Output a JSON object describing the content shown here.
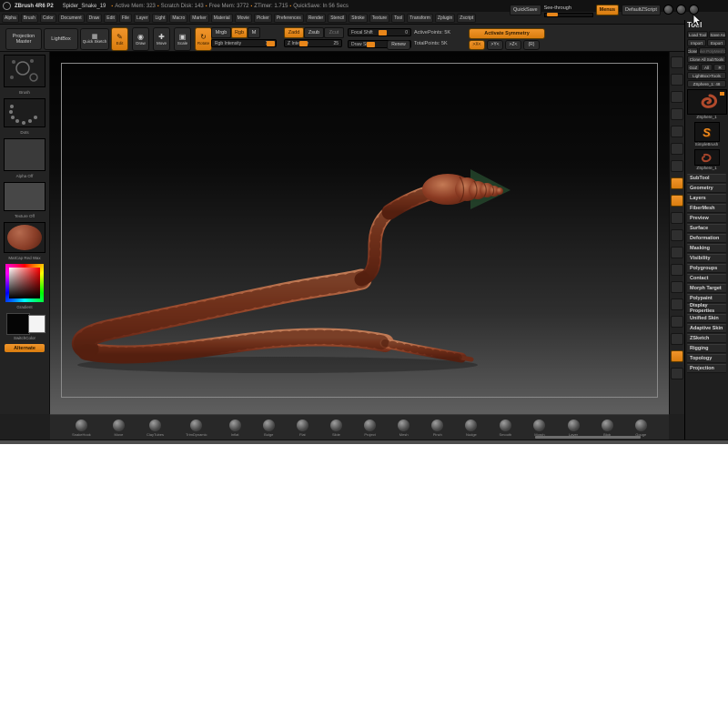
{
  "titlebar": {
    "app_icon_glyph": "◎",
    "app_title": "ZBrush 4R6 P2",
    "doc_title": "Spider_Snake_19",
    "stat_separator": "▪",
    "stats": [
      "Active Mem: 323",
      "Scratch Disk: 143",
      "Free Mem: 3772",
      "ZTimer: 1.715",
      "QuickSave: In 56 Secs"
    ],
    "quicksave": "QuickSave",
    "see_through": "See-through",
    "menus": "Menus",
    "default_zscript": "DefaultZScript"
  },
  "menubar": {
    "items": [
      "Alpha",
      "Brush",
      "Color",
      "Document",
      "Draw",
      "Edit",
      "File",
      "Layer",
      "Light",
      "Macro",
      "Marker",
      "Material",
      "Movie",
      "Picker",
      "Preferences",
      "Render",
      "Stencil",
      "Stroke",
      "Texture",
      "Tool",
      "Transform",
      "Zplugin",
      "Zscript"
    ]
  },
  "shelf": {
    "projection_master": "Projection Master",
    "lightbox": "LightBox",
    "quick_sketch": "Quick Sketch",
    "quick_sketch_glyph": "▦",
    "modes": [
      {
        "label": "Edit",
        "glyph": "✎",
        "icon": "pencil-edit",
        "active": true
      },
      {
        "label": "Draw",
        "glyph": "◉",
        "icon": "draw-dot",
        "active": false
      },
      {
        "label": "Move",
        "glyph": "✚",
        "icon": "move-cross",
        "active": false
      },
      {
        "label": "Scale",
        "glyph": "▣",
        "icon": "scale-box",
        "active": false
      },
      {
        "label": "Rotate",
        "glyph": "↻",
        "icon": "rotate-arrow",
        "active": true
      }
    ],
    "paint": {
      "mrgb": "Mrgb",
      "rgb": "Rgb",
      "m": "M",
      "intensity_label": "Rgb Intensity",
      "intensity_value": "100"
    },
    "sculpt": {
      "zadd": "Zadd",
      "zsub": "Zsub",
      "zcut": "Zcut",
      "intensity_label": "Z Intensity",
      "intensity_value": "25"
    },
    "focal": {
      "label": "Focal Shift",
      "value": "0"
    },
    "draw_size": {
      "label": "Draw Size",
      "value": "64"
    },
    "renew": "Renew",
    "points": {
      "active_label": "ActivePoints:",
      "active_value": "5K",
      "total_label": "TotalPoints:",
      "total_value": "5K"
    },
    "symmetry": {
      "activate": "Activate Symmetry",
      "x": ">X<",
      "y": ">Y<",
      "z": ">Z<",
      "r": "(R)"
    }
  },
  "left_shelf": {
    "brush_label": "Brush",
    "stroke_label": "Dots",
    "alpha_label": "Alpha Off",
    "texture_label": "Texture Off",
    "material_label": "MatCap Red Wax",
    "gradient_label": "Gradient",
    "switch_label": "SwitchColor",
    "alternate_label": "Alternate"
  },
  "right_strip": {
    "button_count": 19,
    "active_indexes": [
      7,
      8,
      17
    ]
  },
  "tool_panel": {
    "header": "Tool",
    "rows": [
      [
        "Load Tool",
        "Save As"
      ],
      [
        "Import",
        "Export"
      ],
      [
        "Clone",
        "Make PolyMesh3D"
      ],
      [
        "Clone All SubTools"
      ],
      [
        "GoZ",
        "All",
        "R"
      ],
      [
        "LightBox>Tools"
      ],
      [
        "ZSphere_1: 48"
      ]
    ],
    "disabled_button": "Make PolyMesh3D",
    "active_tool_label": "ZSphere_1",
    "slot1_glyph": "S",
    "slot1_label": "SimpleBrush",
    "slot2_label": "ZSphere_1",
    "sections": [
      "SubTool",
      "Geometry",
      "Layers",
      "FiberMesh",
      "Preview",
      "Surface",
      "Deformation",
      "Masking",
      "Visibility",
      "Polygroups",
      "Contact",
      "Morph Target",
      "Polypaint",
      "Display Properties",
      "Unified Skin",
      "Adaptive Skin",
      "ZSketch",
      "Rigging",
      "Topology",
      "Projection"
    ]
  },
  "bottom_tray": {
    "items": [
      {
        "label": "SnakeHook"
      },
      {
        "label": "Move"
      },
      {
        "label": "ClayTubes"
      },
      {
        "label": "TrimDynamic"
      },
      {
        "label": "Inflat"
      },
      {
        "label": "Bulge"
      },
      {
        "label": "Flat"
      },
      {
        "label": "Slide"
      },
      {
        "label": "Project"
      },
      {
        "label": "Mesh"
      },
      {
        "label": "Pinch"
      },
      {
        "label": "Nudge"
      },
      {
        "label": "Smooth"
      },
      {
        "label": "Morph"
      },
      {
        "label": "Layer"
      },
      {
        "label": "Blob"
      },
      {
        "label": "Gouge"
      }
    ]
  },
  "colors": {
    "accent": "#E8861A",
    "canvas_top": "#030303",
    "canvas_bottom": "#5F5F5F",
    "snake_base": "#9A452C",
    "snake_dark": "#5A2413",
    "cone_green": "#24452B"
  }
}
